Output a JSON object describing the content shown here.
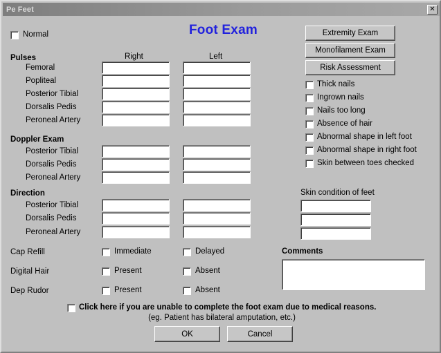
{
  "window": {
    "title": "Pe Feet",
    "close_label": "✕"
  },
  "header": {
    "form_title": "Foot Exam",
    "normal_label": "Normal",
    "title_color": "#2222dd"
  },
  "columns": {
    "right": "Right",
    "left": "Left"
  },
  "sections": {
    "pulses": {
      "heading": "Pulses",
      "rows": [
        {
          "label": "Femoral",
          "right_value": "",
          "left_value": ""
        },
        {
          "label": "Popliteal",
          "right_value": "",
          "left_value": ""
        },
        {
          "label": "Posterior Tibial",
          "right_value": "",
          "left_value": ""
        },
        {
          "label": "Dorsalis Pedis",
          "right_value": "",
          "left_value": ""
        },
        {
          "label": "Peroneal Artery",
          "right_value": "",
          "left_value": ""
        }
      ]
    },
    "doppler": {
      "heading": "Doppler Exam",
      "rows": [
        {
          "label": "Posterior Tibial",
          "right_value": "",
          "left_value": ""
        },
        {
          "label": "Dorsalis Pedis",
          "right_value": "",
          "left_value": ""
        },
        {
          "label": "Peroneal Artery",
          "right_value": "",
          "left_value": ""
        }
      ]
    },
    "direction": {
      "heading": "Direction",
      "rows": [
        {
          "label": "Posterior Tibial",
          "right_value": "",
          "left_value": ""
        },
        {
          "label": "Dorsalis Pedis",
          "right_value": "",
          "left_value": ""
        },
        {
          "label": "Peroneal Artery",
          "right_value": "",
          "left_value": ""
        }
      ]
    }
  },
  "assessments": [
    {
      "label": "Cap Refill",
      "option_a": "Immediate",
      "option_b": "Delayed",
      "checked_a": false,
      "checked_b": false
    },
    {
      "label": "Digital Hair",
      "option_a": "Present",
      "option_b": "Absent",
      "checked_a": false,
      "checked_b": false
    },
    {
      "label": "Dep Rudor",
      "option_a": "Present",
      "option_b": "Absent",
      "checked_a": false,
      "checked_b": false
    }
  ],
  "side_buttons": [
    {
      "label": "Extremity Exam"
    },
    {
      "label": "Monofilament Exam"
    },
    {
      "label": "Risk Assessment"
    }
  ],
  "findings": [
    {
      "label": "Thick nails",
      "checked": false
    },
    {
      "label": "Ingrown nails",
      "checked": false
    },
    {
      "label": "Nails too long",
      "checked": false
    },
    {
      "label": "Absence of hair",
      "checked": false
    },
    {
      "label": "Abnormal shape in left foot",
      "checked": false
    },
    {
      "label": "Abnormal shape in right foot",
      "checked": false
    },
    {
      "label": "Skin between toes checked",
      "checked": false
    }
  ],
  "skin_condition": {
    "heading": "Skin condition of feet",
    "lines": [
      "",
      "",
      ""
    ]
  },
  "comments": {
    "heading": "Comments",
    "value": ""
  },
  "unable": {
    "checkbox_label": "Click here if you are unable to complete the foot exam due to medical reasons.",
    "note": "(eg. Patient has bilateral amputation, etc.)",
    "checked": false
  },
  "footer": {
    "ok_label": "OK",
    "cancel_label": "Cancel"
  }
}
